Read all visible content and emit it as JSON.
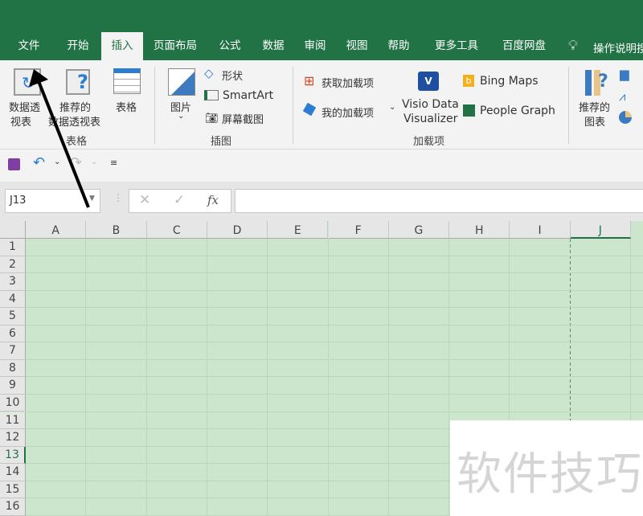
{
  "ribbon_tabs": [
    "文件",
    "开始",
    "插入",
    "页面布局",
    "公式",
    "数据",
    "审阅",
    "视图",
    "帮助",
    "更多工具",
    "百度网盘"
  ],
  "active_tab": "插入",
  "tell_me": "操作说明搜",
  "groups": {
    "tables": {
      "label": "表格",
      "pivot_line1": "数据透",
      "pivot_line2": "视表",
      "recommended_line1": "推荐的",
      "recommended_line2": "数据透视表",
      "table": "表格"
    },
    "illustrations": {
      "label": "插图",
      "pictures": "图片",
      "shapes": "形状",
      "smartart": "SmartArt",
      "screenshot": "屏幕截图"
    },
    "addins": {
      "label": "加载项",
      "get_addins": "获取加载项",
      "my_addins": "我的加载项",
      "visio_line1": "Visio Data",
      "visio_line2": "Visualizer",
      "bing_maps": "Bing Maps",
      "people_graph": "People Graph"
    },
    "charts": {
      "recommended_line1": "推荐的",
      "recommended_line2": "图表"
    }
  },
  "name_box": "J13",
  "formula_value": "",
  "fx": "fx",
  "columns": [
    "A",
    "B",
    "C",
    "D",
    "E",
    "F",
    "G",
    "H",
    "I",
    "J"
  ],
  "rows": [
    "1",
    "2",
    "3",
    "4",
    "5",
    "6",
    "7",
    "8",
    "9",
    "10",
    "11",
    "12",
    "13",
    "14",
    "15",
    "16"
  ],
  "selected_cell": "J13",
  "watermark": "软件技巧",
  "colors": {
    "brand": "#217346",
    "cell_fill": "#cce6cd"
  }
}
